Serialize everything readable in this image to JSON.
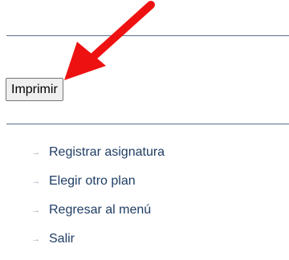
{
  "actions": {
    "print_label": "Imprimir"
  },
  "menu": {
    "items": [
      {
        "label": "Registrar asignatura",
        "icon": "arrow-right-icon"
      },
      {
        "label": "Elegir otro plan",
        "icon": "arrow-right-icon"
      },
      {
        "label": "Regresar al menú",
        "icon": "arrow-right-icon"
      },
      {
        "label": "Salir",
        "icon": "arrow-right-icon"
      }
    ]
  },
  "annotation": {
    "icon": "red-pointer-arrow-icon",
    "color": "#ee1111"
  },
  "colors": {
    "divider": "#5a7088",
    "link": "#1f3d63",
    "bullet": "#9aa7b5"
  }
}
